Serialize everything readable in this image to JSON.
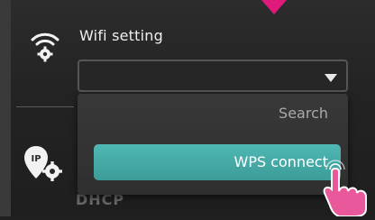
{
  "wifi_setting": {
    "label": "Wifi setting"
  },
  "network_dropdown": {
    "selected_value": ""
  },
  "dropdown_menu": {
    "items": [
      {
        "label": "Search",
        "highlighted": false
      },
      {
        "label": "WPS connect",
        "highlighted": true
      }
    ]
  },
  "ip_setting": {
    "partial_label": "DHCP"
  },
  "icons": {
    "wifi": "wifi-gear-icon",
    "ip": "ip-location-gear-icon",
    "pointer": "down-arrow-indicator-icon",
    "hand": "tapping-hand-icon"
  },
  "colors": {
    "background": "#232323",
    "highlight": "#46aaa6",
    "pointer": "#e0197d",
    "hand": "#e8589b"
  }
}
